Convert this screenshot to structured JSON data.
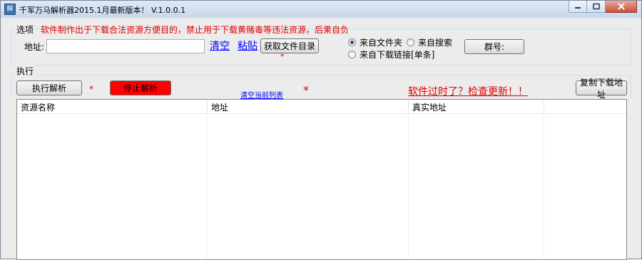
{
  "window": {
    "title": "千军万马解析器2015.1月最新版本！ V.1.0.0.1",
    "icon": "app-icon"
  },
  "options_group": {
    "label": "选项",
    "warning": "软件制作出于下载合法资源方便目的，禁止用于下载黄赌毒等违法资源，后果自负",
    "address_label": "地址:",
    "address_value": "",
    "clear_link": "清空",
    "paste_link": "粘贴",
    "get_dir_button": "获取文件目录",
    "star": "*",
    "radios": [
      {
        "label": "来自文件夹",
        "checked": true
      },
      {
        "label": "来自搜索",
        "checked": false
      },
      {
        "label": "来自下载链接[单条]",
        "checked": false
      }
    ],
    "group_button": "群号:"
  },
  "exec_group": {
    "label": "执行",
    "execute_button": "执行解析",
    "stop_button": "停止解析",
    "star1": "*",
    "star2": "*",
    "clear_list_link": "清空当前列表",
    "update_link": "软件过时了？检查更新！！",
    "copy_button": "复制下载地址"
  },
  "table": {
    "columns": [
      "资源名称",
      "地址",
      "真实地址",
      ""
    ]
  },
  "colors": {
    "warning": "#e00000",
    "link": "#0000ff",
    "stop_button": "#ff0000"
  }
}
